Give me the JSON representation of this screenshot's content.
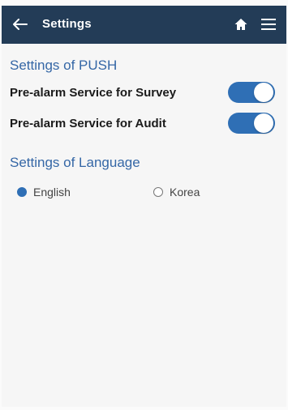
{
  "header": {
    "title": "Settings",
    "back_icon": "arrow-left-icon",
    "home_icon": "home-icon",
    "menu_icon": "hamburger-menu-icon",
    "bar_color": "#233c57"
  },
  "push": {
    "title": "Settings of PUSH",
    "items": [
      {
        "label": "Pre-alarm Service for Survey",
        "enabled": true
      },
      {
        "label": "Pre-alarm Service for Audit",
        "enabled": true
      }
    ]
  },
  "language": {
    "title": "Settings of Language",
    "options": [
      {
        "label": "English",
        "selected": true
      },
      {
        "label": "Korea",
        "selected": false
      }
    ]
  },
  "colors": {
    "accent": "#2f6fb5",
    "section_title": "#3567a6"
  }
}
